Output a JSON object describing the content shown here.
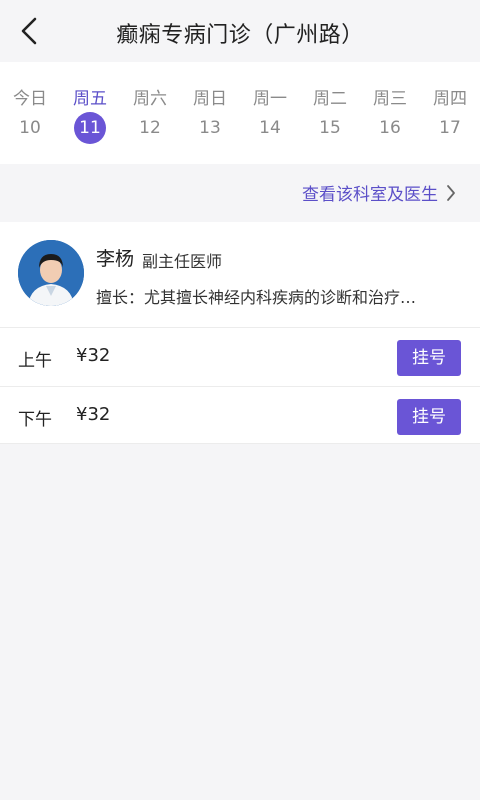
{
  "header": {
    "title": "癫痫专病门诊（广州路）"
  },
  "days": [
    {
      "weekday": "今日",
      "date": "10",
      "active": false
    },
    {
      "weekday": "周五",
      "date": "11",
      "active": true
    },
    {
      "weekday": "周六",
      "date": "12",
      "active": false
    },
    {
      "weekday": "周日",
      "date": "13",
      "active": false
    },
    {
      "weekday": "周一",
      "date": "14",
      "active": false
    },
    {
      "weekday": "周二",
      "date": "15",
      "active": false
    },
    {
      "weekday": "周三",
      "date": "16",
      "active": false
    },
    {
      "weekday": "周四",
      "date": "17",
      "active": false
    }
  ],
  "dept_link": {
    "label": "查看该科室及医生"
  },
  "doctor": {
    "name": "李杨",
    "title": "副主任医师",
    "skill": "擅长：尤其擅长神经内科疾病的诊断和治疗…"
  },
  "slots": [
    {
      "period": "上午",
      "price": "¥32",
      "button": "挂号"
    },
    {
      "period": "下午",
      "price": "¥32",
      "button": "挂号"
    }
  ],
  "colors": {
    "accent": "#6a55d6",
    "accent_text": "#5b4fc8",
    "background": "#f5f5f7"
  }
}
